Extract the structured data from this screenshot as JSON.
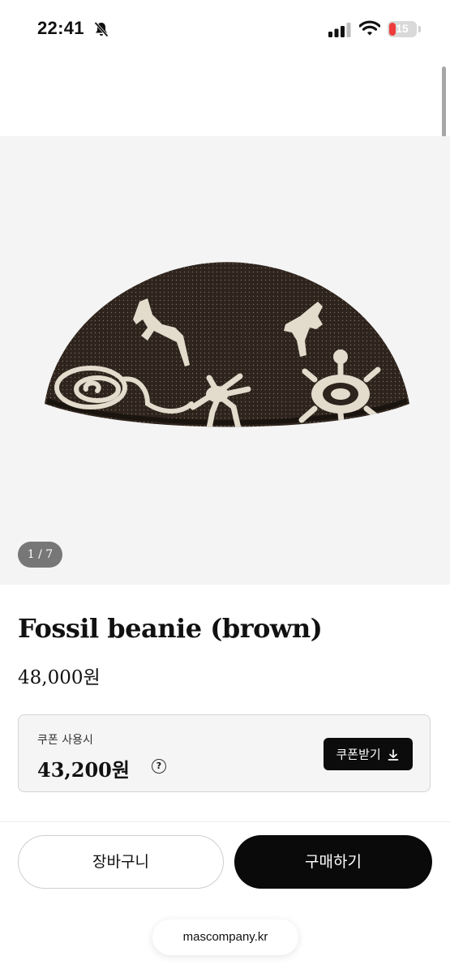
{
  "status_bar": {
    "time": "22:41",
    "battery_level": "15"
  },
  "gallery": {
    "counter": "1 / 7"
  },
  "product": {
    "title": "Fossil beanie (brown)",
    "price": "48,000원"
  },
  "coupon": {
    "label": "쿠폰 사용시",
    "price": "43,200원",
    "help_symbol": "?",
    "button_label": "쿠폰받기"
  },
  "actions": {
    "cart_label": "장바구니",
    "buy_label": "구매하기"
  },
  "browser": {
    "url": "mascompany.kr"
  },
  "colors": {
    "primary": "#0a0a0a",
    "battery_low": "#ee3b3b",
    "beanie": "#2e241d",
    "motif": "#e3dccd"
  }
}
